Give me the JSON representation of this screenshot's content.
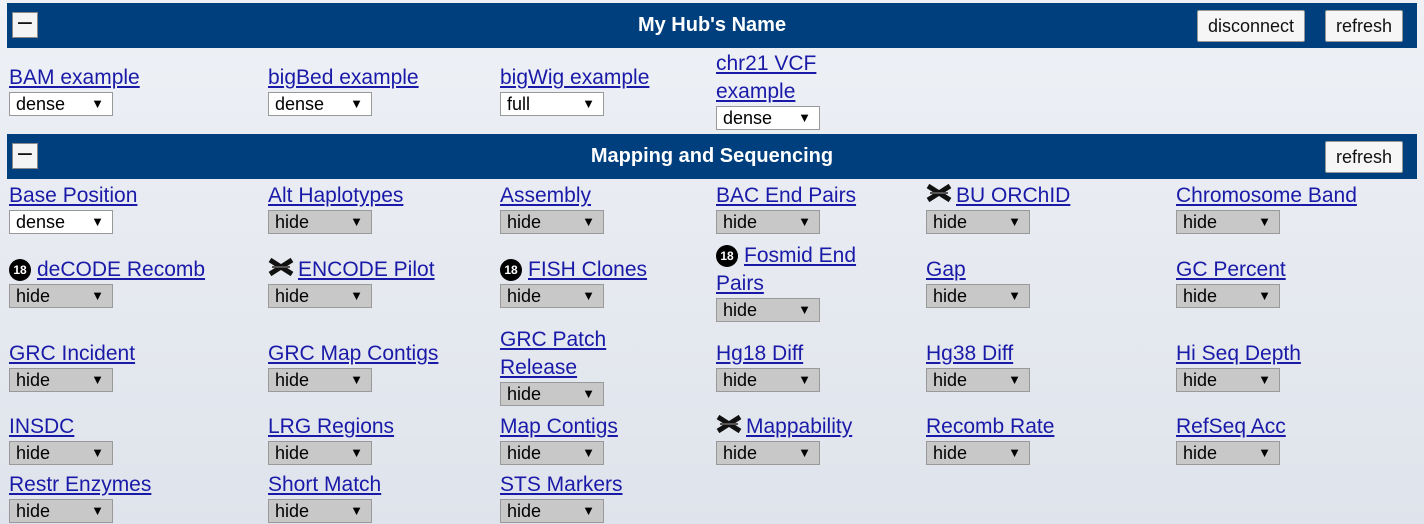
{
  "hub": {
    "title": "My Hub's Name",
    "toggle": "−",
    "disconnect_label": "disconnect",
    "refresh_label": "refresh",
    "tracks": [
      {
        "name": "BAM example",
        "value": "dense"
      },
      {
        "name": "bigBed example",
        "value": "dense"
      },
      {
        "name": "bigWig example",
        "value": "full"
      },
      {
        "name": "chr21 VCF example",
        "value": "dense"
      }
    ]
  },
  "mapping": {
    "title": "Mapping and Sequencing",
    "toggle": "−",
    "refresh_label": "refresh",
    "arrow": "▼",
    "badge_text": "18",
    "tracks": [
      {
        "name": "Base Position",
        "value": "dense"
      },
      {
        "name": "Alt Haplotypes",
        "value": "hide"
      },
      {
        "name": "Assembly",
        "value": "hide"
      },
      {
        "name": "BAC End Pairs",
        "value": "hide"
      },
      {
        "name": "BU ORChID",
        "value": "hide",
        "icon": "crossed-out-icon"
      },
      {
        "name": "Chromosome Band",
        "value": "hide"
      },
      {
        "name": "deCODE Recomb",
        "value": "hide",
        "icon": "hg18-badge-icon"
      },
      {
        "name": "ENCODE Pilot",
        "value": "hide",
        "icon": "crossed-out-icon"
      },
      {
        "name": "FISH Clones",
        "value": "hide",
        "icon": "hg18-badge-icon"
      },
      {
        "name": "Fosmid End Pairs",
        "value": "hide",
        "icon": "hg18-badge-icon"
      },
      {
        "name": "Gap",
        "value": "hide"
      },
      {
        "name": "GC Percent",
        "value": "hide"
      },
      {
        "name": "GRC Incident",
        "value": "hide"
      },
      {
        "name": "GRC Map Contigs",
        "value": "hide"
      },
      {
        "name": "GRC Patch Release",
        "value": "hide"
      },
      {
        "name": "Hg18 Diff",
        "value": "hide"
      },
      {
        "name": "Hg38 Diff",
        "value": "hide"
      },
      {
        "name": "Hi Seq Depth",
        "value": "hide"
      },
      {
        "name": "INSDC",
        "value": "hide"
      },
      {
        "name": "LRG Regions",
        "value": "hide"
      },
      {
        "name": "Map Contigs",
        "value": "hide"
      },
      {
        "name": "Mappability",
        "value": "hide",
        "icon": "crossed-out-icon"
      },
      {
        "name": "Recomb Rate",
        "value": "hide"
      },
      {
        "name": "RefSeq Acc",
        "value": "hide"
      },
      {
        "name": "Restr Enzymes",
        "value": "hide"
      },
      {
        "name": "Short Match",
        "value": "hide"
      },
      {
        "name": "STS Markers",
        "value": "hide"
      }
    ]
  }
}
